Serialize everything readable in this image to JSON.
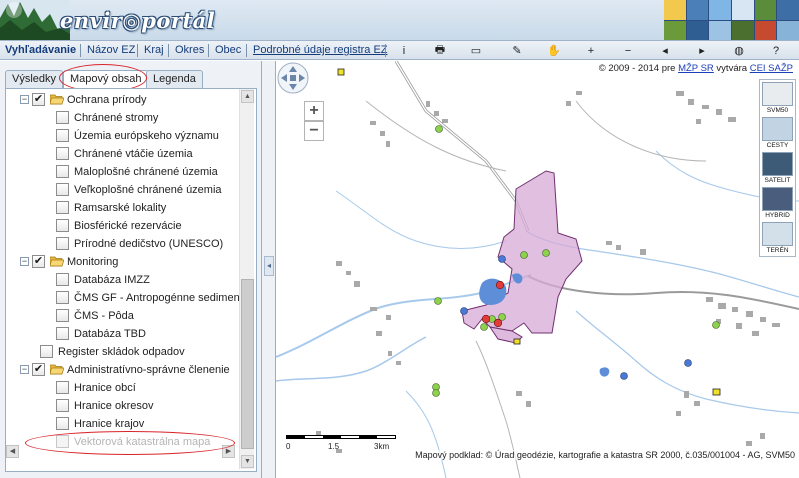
{
  "header": {
    "logo_text": "envir◎portál"
  },
  "toolbar": {
    "nav": [
      {
        "label": "Vyhľadávanie"
      },
      {
        "label": "Názov EZ"
      },
      {
        "label": "Kraj"
      },
      {
        "label": "Okres"
      },
      {
        "label": "Obec"
      },
      {
        "label": "Podrobné údaje registra EZ"
      }
    ],
    "tools": [
      "info-icon",
      "print-icon",
      "ruler-icon",
      "eraser-icon",
      "hand-icon",
      "zoom-in-icon",
      "zoom-out-icon",
      "zoom-previous-icon",
      "zoom-next-icon",
      "globe-icon",
      "help-icon"
    ],
    "tool_glyphs": [
      "i",
      "🖶",
      "▭",
      "✎",
      "✋",
      "+",
      "−",
      "◂",
      "▸",
      "◍",
      "?"
    ]
  },
  "left_panel": {
    "tabs": [
      {
        "label": "Výsledky"
      },
      {
        "label": "Mapový obsah"
      },
      {
        "label": "Legenda"
      }
    ],
    "active_tab": "Mapový obsah",
    "tree": [
      {
        "label": "Ochrana prírody",
        "level": 0,
        "checked": true,
        "folder": true,
        "expander": "−"
      },
      {
        "label": "Chránené stromy",
        "level": 1,
        "checked": false
      },
      {
        "label": "Územia európskeho významu",
        "level": 1,
        "checked": false
      },
      {
        "label": "Chránené vtáčie územia",
        "level": 1,
        "checked": false
      },
      {
        "label": "Maloplošné chránené územia",
        "level": 1,
        "checked": false
      },
      {
        "label": "Veľkoplošné chránené územia",
        "level": 1,
        "checked": false
      },
      {
        "label": "Ramsarské lokality",
        "level": 1,
        "checked": false
      },
      {
        "label": "Biosférické rezervácie",
        "level": 1,
        "checked": false
      },
      {
        "label": "Prírodné dedičstvo (UNESCO)",
        "level": 1,
        "checked": false
      },
      {
        "label": "Monitoring",
        "level": 0,
        "checked": true,
        "folder": true,
        "expander": "−"
      },
      {
        "label": "Databáza IMZZ",
        "level": 1,
        "checked": false
      },
      {
        "label": "ČMS GF - Antropogénne sedimenty",
        "level": 1,
        "checked": false
      },
      {
        "label": "ČMS - Pôda",
        "level": 1,
        "checked": false
      },
      {
        "label": "Databáza TBD",
        "level": 1,
        "checked": false
      },
      {
        "label": "Register skládok odpadov",
        "level": -1,
        "checked": false
      },
      {
        "label": "Administratívno-správne členenie",
        "level": 0,
        "checked": true,
        "folder": true,
        "expander": "−"
      },
      {
        "label": "Hranice obcí",
        "level": 1,
        "checked": false
      },
      {
        "label": "Hranice okresov",
        "level": 1,
        "checked": false
      },
      {
        "label": "Hranice krajov",
        "level": 1,
        "checked": false
      },
      {
        "label": "Vektorová katastrálna mapa",
        "level": 1,
        "checked": false,
        "disabled": true
      }
    ]
  },
  "map": {
    "copyright": {
      "prefix": "© 2009 - 2014 pre ",
      "link1": "MŽP SR",
      "middle": " vytvára ",
      "link2": "CEI SAŽP"
    },
    "zoom_in": "+",
    "zoom_out": "−",
    "layers": [
      {
        "label": "SVM50",
        "color": "#e8ecef"
      },
      {
        "label": "CESTY",
        "color": "#c2d4e3"
      },
      {
        "label": "SATELIT",
        "color": "#3d5a77"
      },
      {
        "label": "HYBRID",
        "color": "#4a5d7c"
      },
      {
        "label": "TERÉN",
        "color": "#d3e0ea"
      }
    ],
    "scale": {
      "ticks": [
        "0",
        "1.5",
        "3km"
      ]
    },
    "credit": "Mapový podklad: © Úrad geodézie, kartografie a katastra SR 2000, č.035/001004 - AG, SVM50"
  }
}
